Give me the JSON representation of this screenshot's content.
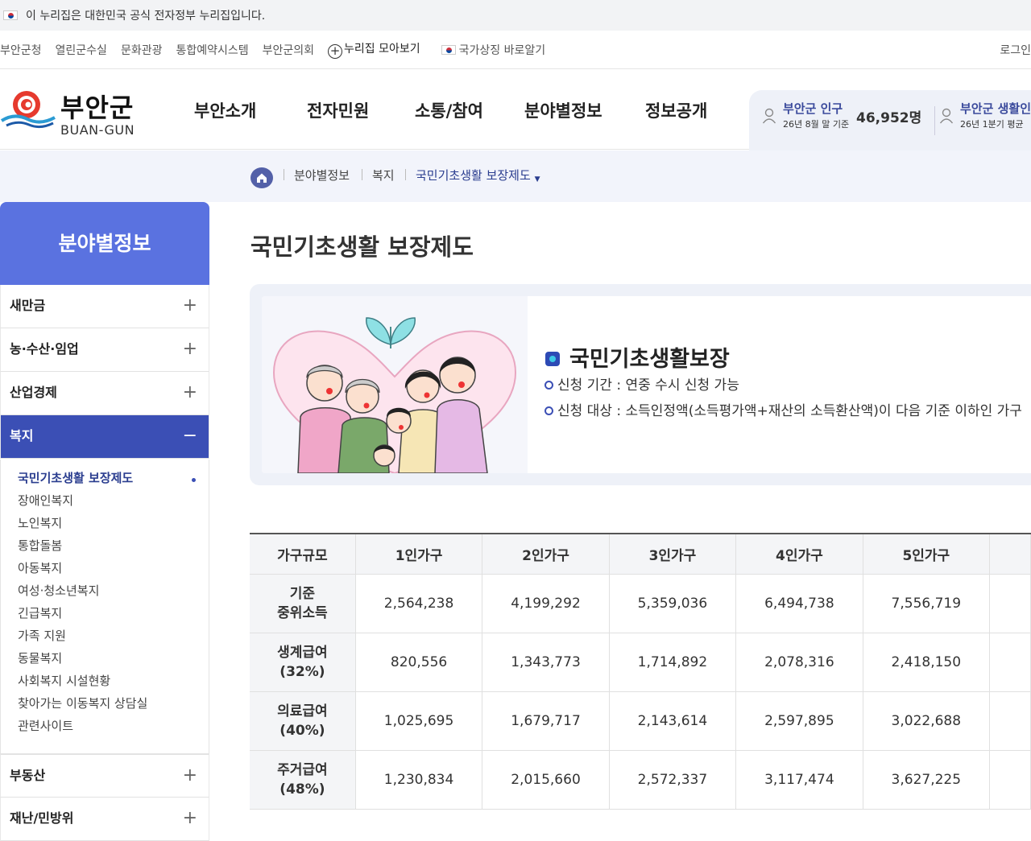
{
  "gov_banner": {
    "text": "이 누리집은 대한민국 공식 전자정부 누리집입니다."
  },
  "util_links": [
    "부안군청",
    "열린군수실",
    "문화관광",
    "통합예약시스템",
    "부안군의회"
  ],
  "nuri_link": "누리집 모아보기",
  "national_symbol_link": "국가상징 바로알기",
  "login": "로그인",
  "logo": {
    "kr": "부안군",
    "en": "BUAN-GUN"
  },
  "gnb": [
    "부안소개",
    "전자민원",
    "소통/참여",
    "분야별정보",
    "정보공개"
  ],
  "stats": {
    "population_label": "부안군 인구",
    "population_sub": "26년 8월 말 기준",
    "population_value": "46,952명",
    "living_label": "부안군 생활인",
    "living_sub": "26년 1분기 평균"
  },
  "breadcrumb": [
    "분야별정보",
    "복지",
    "국민기초생활 보장제도"
  ],
  "sidebar": {
    "title": "분야별정보",
    "items": [
      "새만금",
      "농·수산·임업",
      "산업경제",
      "복지",
      "부동산",
      "재난/민방위"
    ],
    "active": "복지",
    "sub_items": [
      "국민기초생활 보장제도",
      "장애인복지",
      "노인복지",
      "통합돌봄",
      "아동복지",
      "여성·청소년복지",
      "긴급복지",
      "가족 지원",
      "동물복지",
      "사회복지 시설현황",
      "찾아가는 이동복지 상담실",
      "관련사이트"
    ]
  },
  "page_title": "국민기초생활 보장제도",
  "info": {
    "heading": "국민기초생활보장",
    "line1": "신청 기간 : 연중 수시 신청 가능",
    "line2": "신청 대상 : 소득인정액(소득평가액+재산의 소득환산액)이 다음 기준 이하인 가구"
  },
  "table": {
    "headers": [
      "가구규모",
      "1인가구",
      "2인가구",
      "3인가구",
      "4인가구",
      "5인가구"
    ],
    "rows": [
      {
        "label1": "기준",
        "label2": "중위소득",
        "values": [
          "2,564,238",
          "4,199,292",
          "5,359,036",
          "6,494,738",
          "7,556,719"
        ]
      },
      {
        "label1": "생계급여",
        "label2": "(32%)",
        "values": [
          "820,556",
          "1,343,773",
          "1,714,892",
          "2,078,316",
          "2,418,150"
        ]
      },
      {
        "label1": "의료급여",
        "label2": "(40%)",
        "values": [
          "1,025,695",
          "1,679,717",
          "2,143,614",
          "2,597,895",
          "3,022,688"
        ]
      },
      {
        "label1": "주거급여",
        "label2": "(48%)",
        "values": [
          "1,230,834",
          "2,015,660",
          "2,572,337",
          "3,117,474",
          "3,627,225"
        ]
      }
    ]
  }
}
